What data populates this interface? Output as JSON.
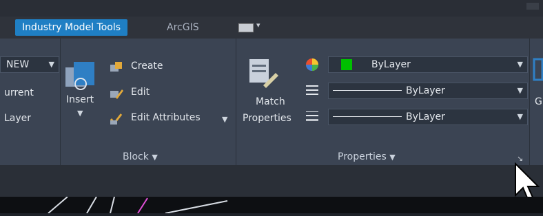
{
  "tabs": {
    "industry_model_tools": "Industry Model Tools",
    "arcgis": "ArcGIS"
  },
  "layer_panel": {
    "state_value": "NEW",
    "make_current_label": "urrent",
    "layer_label": "Layer"
  },
  "block_panel": {
    "insert_label": "Insert",
    "create_label": "Create",
    "edit_label": "Edit",
    "edit_attributes_label": "Edit Attributes",
    "title": "Block"
  },
  "properties_panel": {
    "match_properties_label_1": "Match",
    "match_properties_label_2": "Properties",
    "color_value": "ByLayer",
    "linetype_value": "ByLayer",
    "lineweight_value": "ByLayer",
    "title": "Properties",
    "color_swatch": "#00c000"
  },
  "right_partial": {
    "group_label_fragment": "G"
  },
  "colors": {
    "accent_tab": "#1f7fc4",
    "ribbon_bg": "#3b4453"
  }
}
